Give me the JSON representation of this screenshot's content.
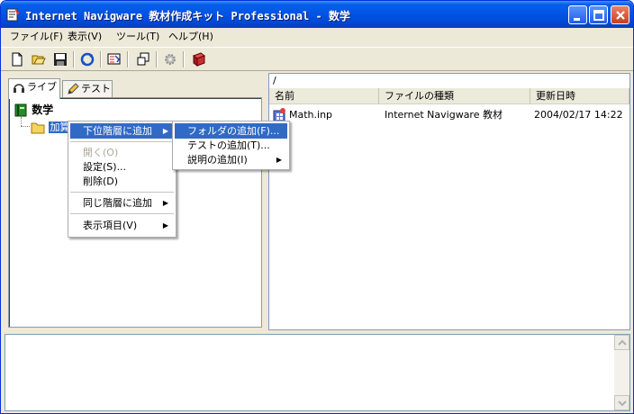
{
  "window": {
    "title": "Internet Navigware 教材作成キット Professional - 数学"
  },
  "menubar": [
    "ファイル(F)",
    "表示(V)",
    "ツール(T)",
    "ヘルプ(H)"
  ],
  "toolbar_icons": [
    "new-file-icon",
    "open-folder-icon",
    "save-icon",
    "refresh-icon",
    "properties-icon",
    "copy-window-icon",
    "settings-gear-icon",
    "book-icon"
  ],
  "left_pane": {
    "tabs": [
      "ライブ",
      "テスト"
    ],
    "tree": {
      "root": "数学",
      "child": "加算"
    }
  },
  "right_pane": {
    "path": "/",
    "columns": [
      "名前",
      "ファイルの種類",
      "更新日時"
    ],
    "rows": [
      {
        "name": "Math.inp",
        "type": "Internet Navigware 教材",
        "date": "2004/02/17 14:22"
      }
    ]
  },
  "context_menu": {
    "items": [
      "下位階層に追加",
      "開く(O)",
      "設定(S)...",
      "削除(D)",
      "同じ階層に追加",
      "表示項目(V)"
    ],
    "submenu": [
      "フォルダの追加(F)...",
      "テストの追加(T)...",
      "説明の追加(I)"
    ]
  },
  "colors": {
    "highlight": "#316ac5",
    "titlebar": "#0055e5"
  }
}
